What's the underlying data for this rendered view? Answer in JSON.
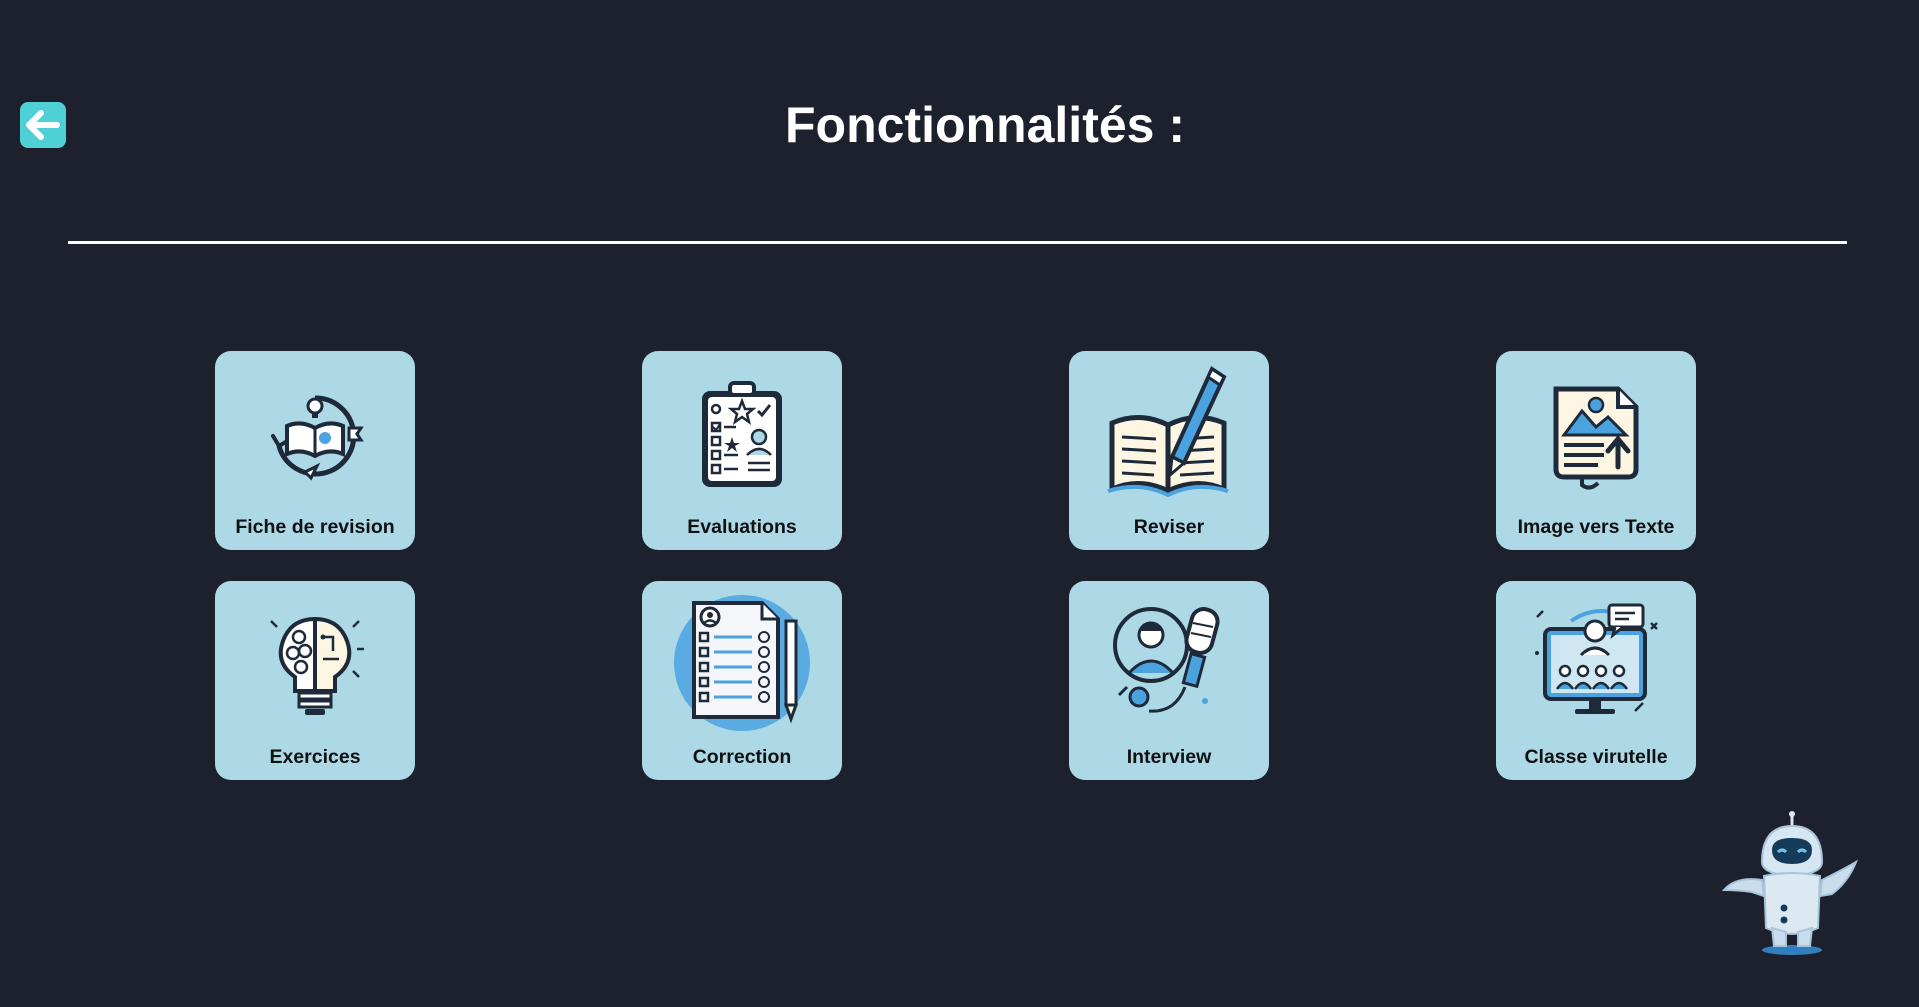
{
  "header": {
    "title": "Fonctionnalités :",
    "back_icon": "arrow-left-icon"
  },
  "features": [
    {
      "label": "Fiche de revision",
      "icon": "book-cycle-icon"
    },
    {
      "label": "Evaluations",
      "icon": "clipboard-checklist-icon"
    },
    {
      "label": "Reviser",
      "icon": "book-pen-icon"
    },
    {
      "label": "Image vers Texte",
      "icon": "image-to-text-icon"
    },
    {
      "label": "Exercices",
      "icon": "brain-lightbulb-icon"
    },
    {
      "label": "Correction",
      "icon": "checklist-pencil-icon"
    },
    {
      "label": "Interview",
      "icon": "person-microphone-icon"
    },
    {
      "label": "Classe virutelle",
      "icon": "virtual-classroom-icon"
    }
  ],
  "assistant": {
    "icon": "robot-assistant-icon"
  },
  "colors": {
    "background": "#1c212d",
    "card": "#add8e6",
    "back_button": "#4fd0d6",
    "accent_blue": "#4aa3df"
  }
}
